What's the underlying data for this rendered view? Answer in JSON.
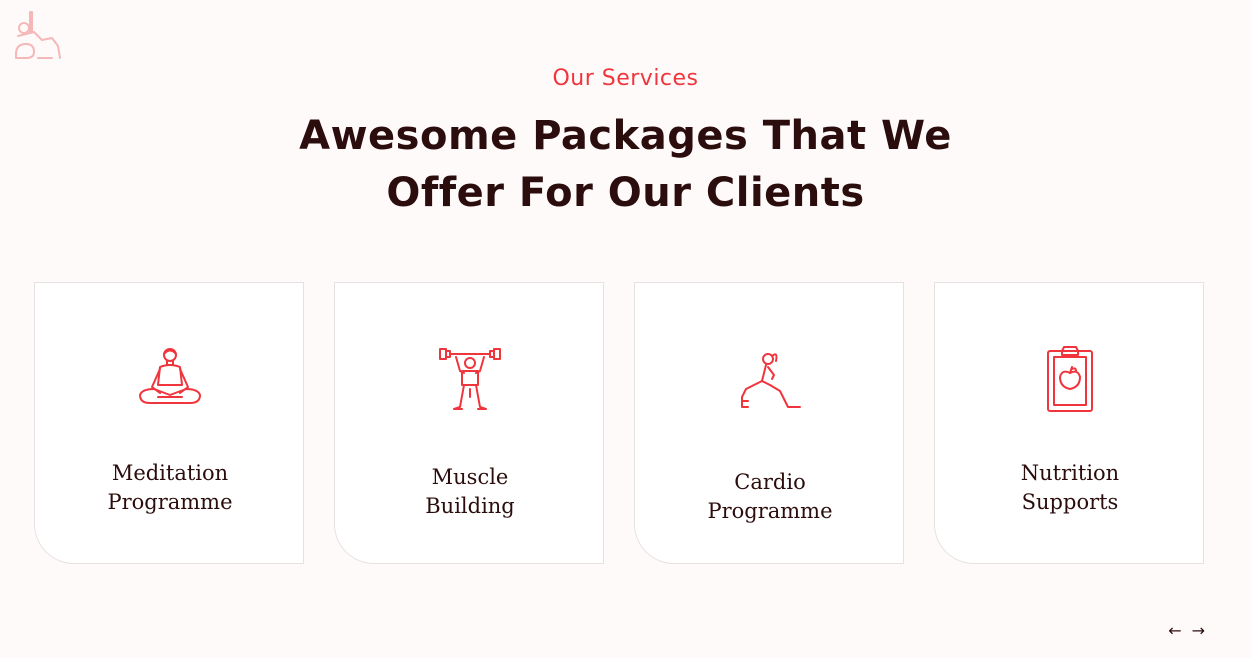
{
  "header": {
    "eyebrow": "Our Services",
    "title_line1": "Awesome Packages That We",
    "title_line2": "Offer For Our Clients"
  },
  "colors": {
    "accent": "#f0353d",
    "text": "#2b0d0d",
    "background": "#fffafa",
    "logo": "#f4b8b8"
  },
  "services": [
    {
      "icon": "meditation-icon",
      "line1": "Meditation",
      "line2": "Programme"
    },
    {
      "icon": "weightlifting-icon",
      "line1": "Muscle",
      "line2": "Building"
    },
    {
      "icon": "lunge-exercise-icon",
      "line1": "Cardio",
      "line2": "Programme"
    },
    {
      "icon": "nutrition-clipboard-icon",
      "line1": "Nutrition",
      "line2": "Supports"
    }
  ],
  "nav": {
    "prev": "←",
    "next": "→"
  }
}
